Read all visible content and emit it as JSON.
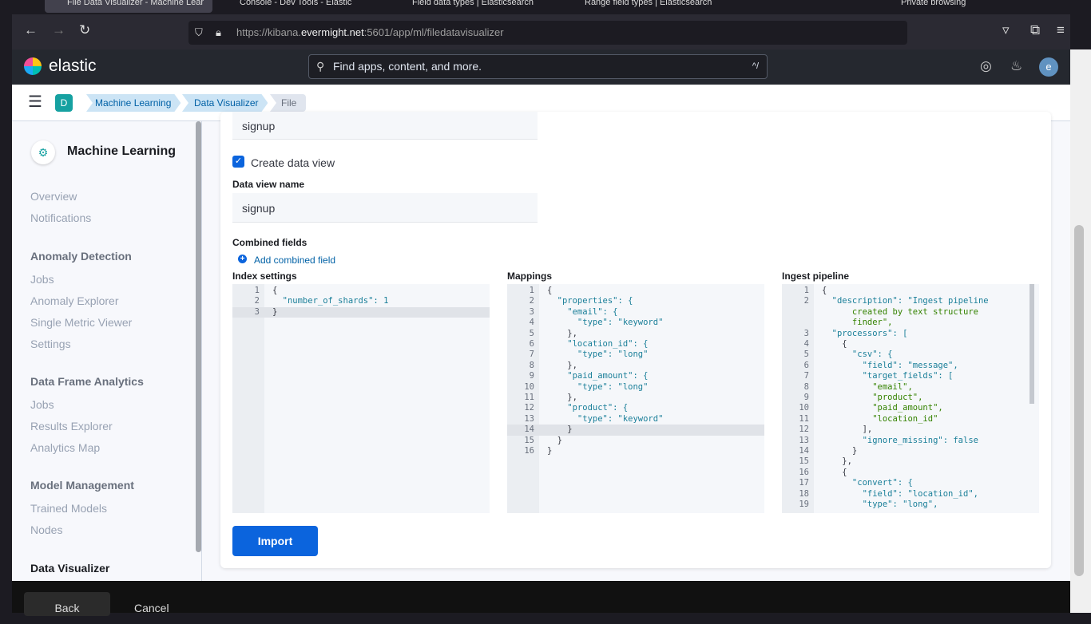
{
  "browser": {
    "tabs": [
      "File Data Visualizer - Machine Lear",
      "Console - Dev Tools - Elastic",
      "Field data types | Elasticsearch",
      "Range field types | Elasticsearch"
    ],
    "private_label": "Private browsing",
    "url_prefix": "https://kibana.",
    "url_domain": "evermight.net",
    "url_suffix": ":5601/app/ml/filedatavisualizer"
  },
  "header": {
    "logo": "elastic",
    "search_placeholder": "Find apps, content, and more.",
    "search_shortcut": "^/",
    "avatar": "e",
    "space": "D"
  },
  "breadcrumbs": [
    "Machine Learning",
    "Data Visualizer",
    "File"
  ],
  "sidebar": {
    "title": "Machine Learning",
    "items": [
      {
        "label": "Overview",
        "type": "item"
      },
      {
        "label": "Notifications",
        "type": "item"
      },
      {
        "label": "Anomaly Detection",
        "type": "heading"
      },
      {
        "label": "Jobs",
        "type": "item"
      },
      {
        "label": "Anomaly Explorer",
        "type": "item"
      },
      {
        "label": "Single Metric Viewer",
        "type": "item"
      },
      {
        "label": "Settings",
        "type": "item"
      },
      {
        "label": "Data Frame Analytics",
        "type": "heading"
      },
      {
        "label": "Jobs",
        "type": "item"
      },
      {
        "label": "Results Explorer",
        "type": "item"
      },
      {
        "label": "Analytics Map",
        "type": "item"
      },
      {
        "label": "Model Management",
        "type": "heading"
      },
      {
        "label": "Trained Models",
        "type": "item"
      },
      {
        "label": "Nodes",
        "type": "item"
      },
      {
        "label": "Data Visualizer",
        "type": "heading-active"
      }
    ]
  },
  "form": {
    "index_name_value": "signup",
    "create_data_view_label": "Create data view",
    "create_data_view_checked": true,
    "data_view_name_label": "Data view name",
    "data_view_name_value": "signup",
    "combined_fields_label": "Combined fields",
    "add_combined_field": "Add combined field",
    "index_settings_label": "Index settings",
    "mappings_label": "Mappings",
    "ingest_pipeline_label": "Ingest pipeline",
    "import_label": "Import"
  },
  "editors": {
    "index_settings": [
      "{",
      "  \"number_of_shards\": 1",
      "}"
    ],
    "mappings": [
      "{",
      "  \"properties\": {",
      "    \"email\": {",
      "      \"type\": \"keyword\"",
      "    },",
      "    \"location_id\": {",
      "      \"type\": \"long\"",
      "    },",
      "    \"paid_amount\": {",
      "      \"type\": \"long\"",
      "    },",
      "    \"product\": {",
      "      \"type\": \"keyword\"",
      "    }",
      "  }",
      "}"
    ],
    "ingest_pipeline": [
      "{",
      "  \"description\": \"Ingest pipeline",
      "      created by text structure",
      "      finder\",",
      "  \"processors\": [",
      "    {",
      "      \"csv\": {",
      "        \"field\": \"message\",",
      "        \"target_fields\": [",
      "          \"email\",",
      "          \"product\",",
      "          \"paid_amount\",",
      "          \"location_id\"",
      "        ],",
      "        \"ignore_missing\": false",
      "      }",
      "    },",
      "    {",
      "      \"convert\": {",
      "        \"field\": \"location_id\",",
      "        \"type\": \"long\","
    ]
  },
  "ingest_line_numbers": [
    "1",
    "2",
    "",
    "",
    "3",
    "4",
    "5",
    "6",
    "7",
    "8",
    "9",
    "10",
    "11",
    "12",
    "13",
    "14",
    "15",
    "16",
    "17",
    "18",
    "19"
  ],
  "footer": {
    "back": "Back",
    "cancel": "Cancel"
  }
}
